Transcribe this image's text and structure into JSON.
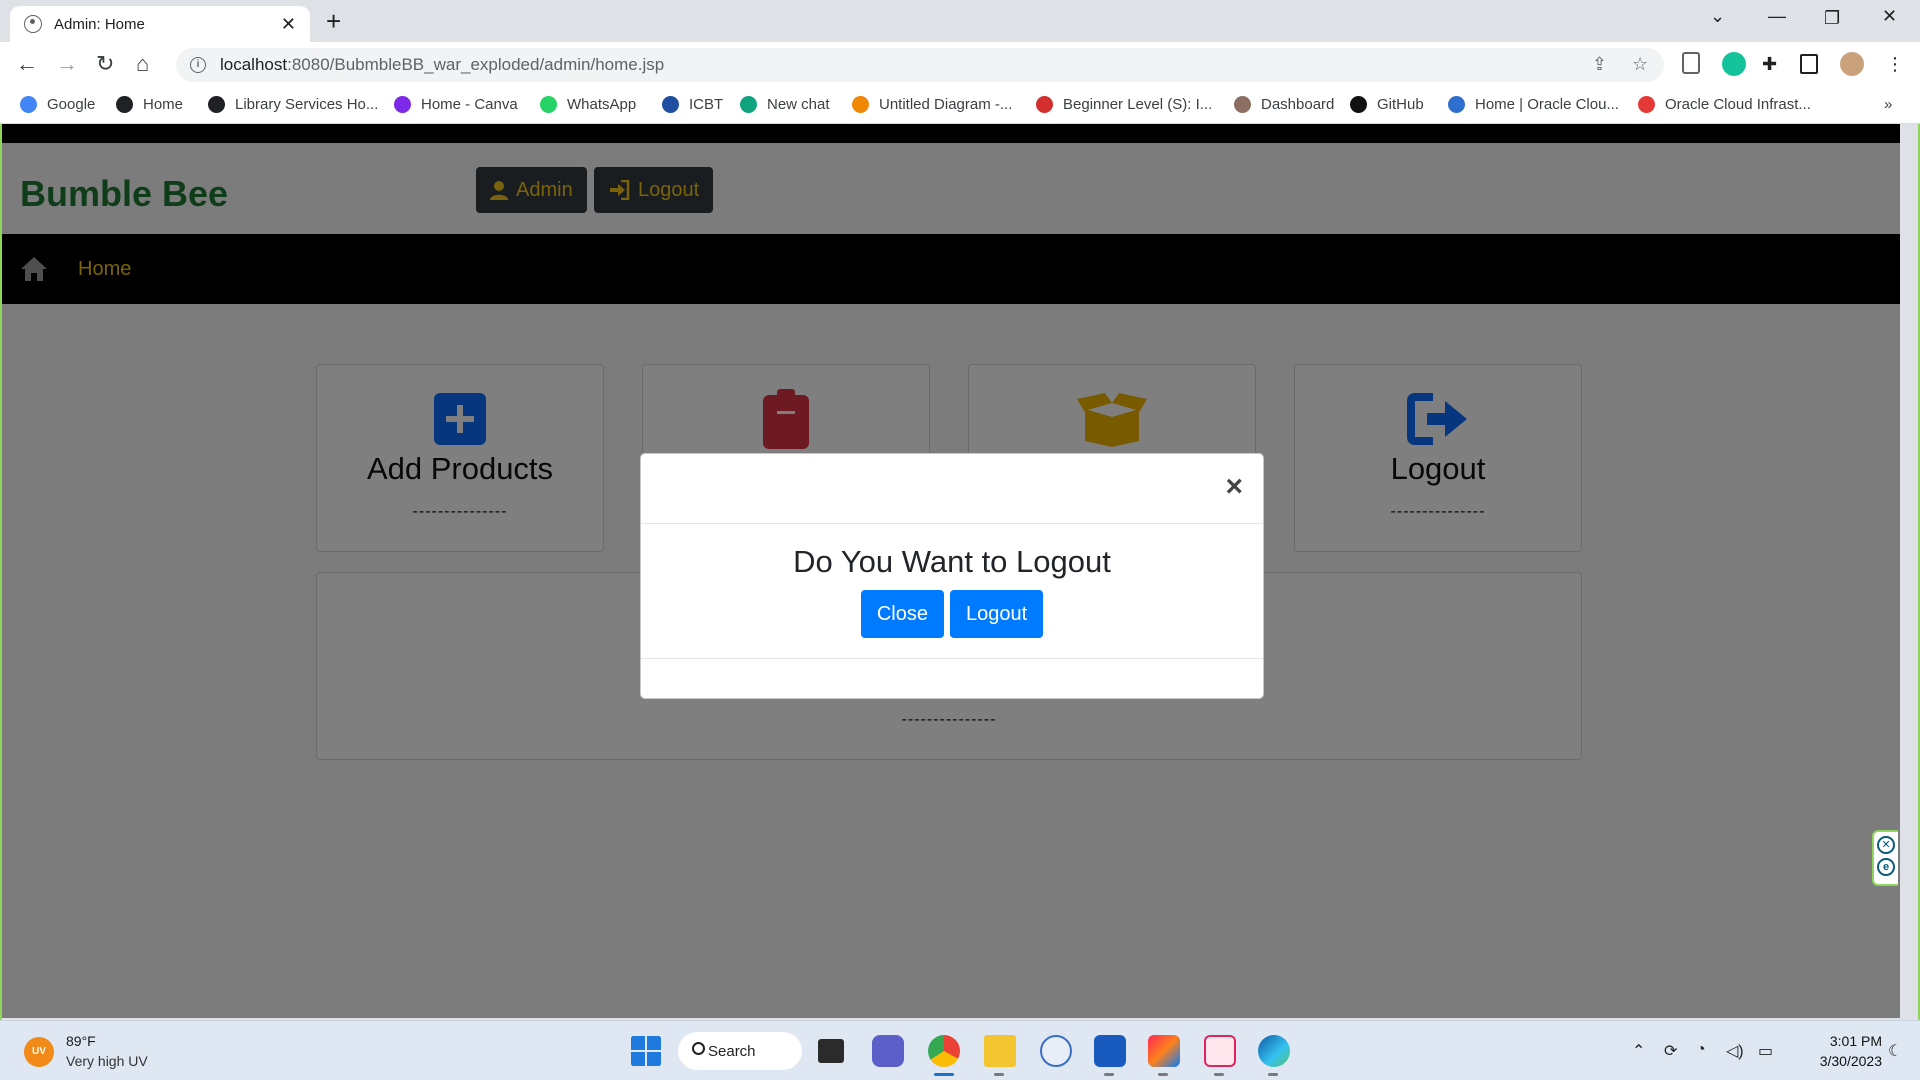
{
  "browser": {
    "tab_title": "Admin: Home",
    "url_host": "localhost",
    "url_path": ":8080/BubmbleBB_war_exploded/admin/home.jsp",
    "bookmarks": [
      {
        "label": "Google",
        "color": "#4285f4"
      },
      {
        "label": "Home",
        "color": "#202124"
      },
      {
        "label": "Library Services Ho...",
        "color": "#202124"
      },
      {
        "label": "Home - Canva",
        "color": "#7d2ae8"
      },
      {
        "label": "WhatsApp",
        "color": "#25d366"
      },
      {
        "label": "ICBT",
        "color": "#1e4fa0"
      },
      {
        "label": "New chat",
        "color": "#10a37f"
      },
      {
        "label": "Untitled Diagram -...",
        "color": "#f08705"
      },
      {
        "label": "Beginner Level (S): I...",
        "color": "#d32f2f"
      },
      {
        "label": "Dashboard",
        "color": "#8d6e63"
      },
      {
        "label": "GitHub",
        "color": "#111111"
      },
      {
        "label": "Home | Oracle Clou...",
        "color": "#2f6fd0"
      },
      {
        "label": "Oracle Cloud Infrast...",
        "color": "#e53935"
      }
    ]
  },
  "site": {
    "brand": "Bumble Bee",
    "admin_button": "Admin",
    "logout_button": "Logout",
    "nav_home": "Home",
    "accent": "#f5c518",
    "brand_color": "#1e7b34"
  },
  "cards": [
    {
      "title": "Add Products",
      "dash": "---------------",
      "icon": "plus-square-icon",
      "color": "#0d6efd"
    },
    {
      "title": "",
      "dash": "",
      "icon": "clipboard-icon",
      "color": "#dc3545"
    },
    {
      "title": "",
      "dash": "",
      "icon": "open-box-icon",
      "color": "#f0b400"
    },
    {
      "title": "Logout",
      "dash": "---------------",
      "icon": "sign-out-icon",
      "color": "#0d6efd"
    },
    {
      "title": "",
      "dash": "---------------",
      "icon": "",
      "color": ""
    }
  ],
  "modal": {
    "title": "Do You Want to Logout",
    "close_button": "Close",
    "logout_button": "Logout",
    "close_x": "×"
  },
  "taskbar": {
    "weather_badge": "UV",
    "temperature": "89°F",
    "weather_desc": "Very high UV",
    "search_label": "Search",
    "time": "3:01 PM",
    "date": "3/30/2023"
  }
}
